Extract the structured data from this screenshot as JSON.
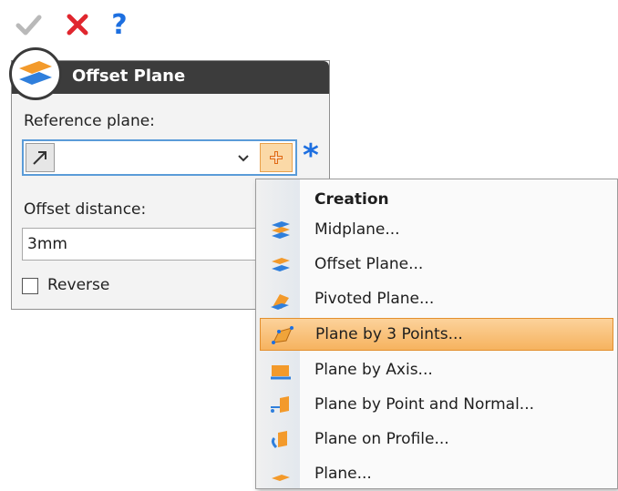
{
  "toolbar": {
    "ok_icon": "check-icon",
    "cancel_icon": "close-icon",
    "help_icon": "help-icon",
    "help_glyph": "?"
  },
  "panel": {
    "title": "Offset Plane",
    "reference_label": "Reference plane:",
    "reference_value": "",
    "offset_label": "Offset distance:",
    "offset_value": "3mm",
    "reverse_label": "Reverse",
    "required_marker": "*"
  },
  "menu": {
    "heading": "Creation",
    "items": [
      {
        "label": "Midplane...",
        "icon": "midplane-icon"
      },
      {
        "label": "Offset Plane...",
        "icon": "offset-plane-icon"
      },
      {
        "label": "Pivoted Plane...",
        "icon": "pivoted-plane-icon"
      },
      {
        "label": "Plane by 3 Points...",
        "icon": "plane-3-points-icon",
        "highlighted": true
      },
      {
        "label": "Plane by Axis...",
        "icon": "plane-axis-icon"
      },
      {
        "label": "Plane by Point and Normal...",
        "icon": "plane-point-normal-icon"
      },
      {
        "label": "Plane on Profile...",
        "icon": "plane-profile-icon"
      },
      {
        "label": "Plane...",
        "icon": "plane-icon"
      }
    ]
  },
  "colors": {
    "accent_blue": "#1d6fe0",
    "highlight_orange": "#f6b35f",
    "title_bar": "#3c3c3c"
  }
}
